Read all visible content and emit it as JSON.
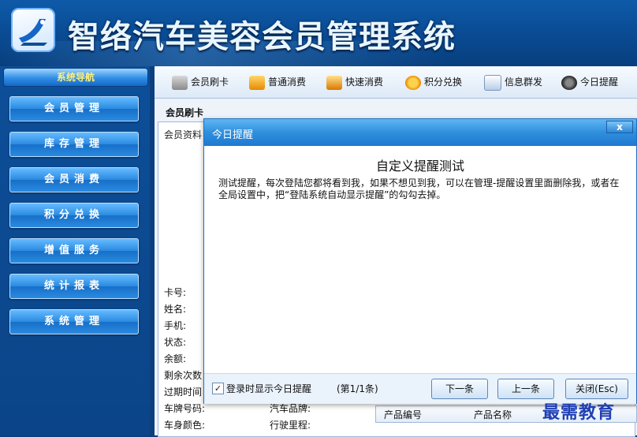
{
  "app": {
    "title": "智络汽车美容会员管理系统"
  },
  "nav": {
    "header": "系统导航",
    "items": [
      {
        "label": "会员管理"
      },
      {
        "label": "库存管理"
      },
      {
        "label": "会员消费"
      },
      {
        "label": "积分兑换"
      },
      {
        "label": "增值服务"
      },
      {
        "label": "统计报表"
      },
      {
        "label": "系统管理"
      }
    ]
  },
  "toolbar": {
    "items": [
      {
        "label": "会员刷卡",
        "icon": "card-icon"
      },
      {
        "label": "普通消费",
        "icon": "consume-icon"
      },
      {
        "label": "快速消费",
        "icon": "quick-consume-icon"
      },
      {
        "label": "积分兑换",
        "icon": "exchange-icon"
      },
      {
        "label": "信息群发",
        "icon": "message-icon"
      },
      {
        "label": "今日提醒",
        "icon": "reminder-icon"
      }
    ]
  },
  "main": {
    "section_title": "会员刷卡",
    "fieldset_legend": "会员资料",
    "fields": [
      "卡号:",
      "姓名:",
      "手机:",
      "状态:",
      "余额:",
      "剩余次数",
      "过期时间",
      "车牌号码:",
      "车身颜色:"
    ],
    "fields_right": [
      "汽车品牌:",
      "行驶里程:"
    ],
    "grid_columns": [
      "产品编号",
      "产品名称"
    ]
  },
  "dialog": {
    "title": "今日提醒",
    "close": "x",
    "heading": "自定义提醒测试",
    "body": "测试提醒，每次登陆您都将看到我，如果不想见到我，可以在管理-提醒设置里面删除我，或者在全局设置中，把“登陆系统自动显示提醒”的勾勾去掉。",
    "checkbox_label": "登录时显示今日提醒",
    "checkbox_checked": true,
    "counter": "(第1/1条)",
    "next_button": "下一条",
    "prev_button": "上一条",
    "close_button": "关闭(Esc)"
  },
  "watermark": "最需教育"
}
